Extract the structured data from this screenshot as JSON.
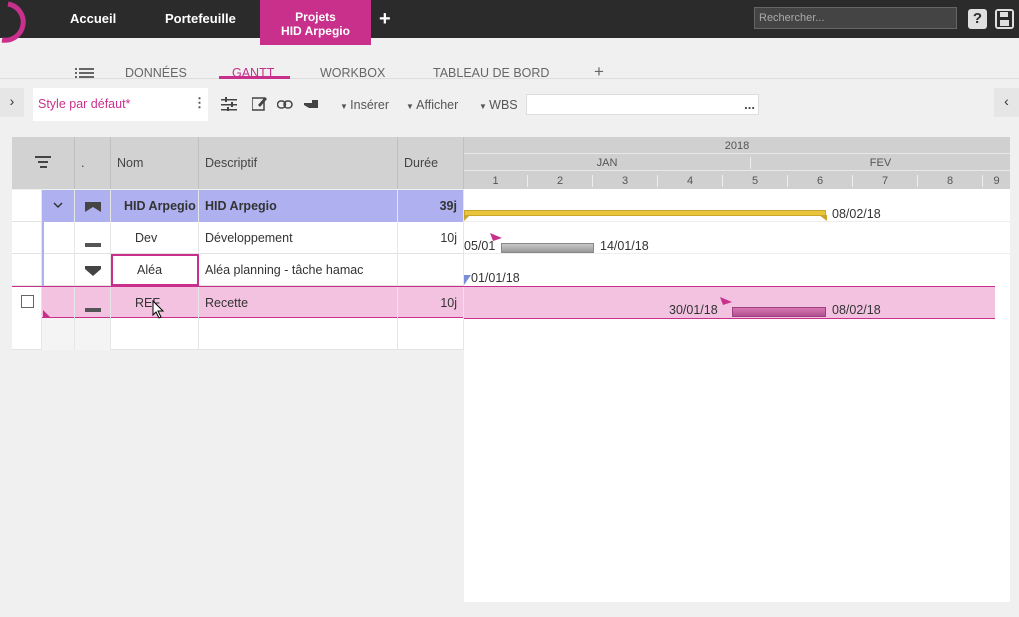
{
  "topbar": {
    "nav_home": "Accueil",
    "nav_portfolio": "Portefeuille",
    "nav_projects": "Projets",
    "nav_project_name": "HID Arpegio",
    "search_placeholder": "Rechercher...",
    "help_icon": "question-icon",
    "save_icon": "save-icon"
  },
  "tabs": {
    "donnees": "DONNÉES",
    "gantt": "GANTT",
    "workbox": "WORKBOX",
    "tableau": "TABLEAU DE BORD"
  },
  "toolbar": {
    "style": "Style par défaut*",
    "inserer": "Insérer",
    "afficher": "Afficher",
    "wbs": "WBS",
    "more": "..."
  },
  "grid": {
    "headers": {
      "dot": ".",
      "nom": "Nom",
      "descriptif": "Descriptif",
      "duree": "Durée"
    },
    "rows": [
      {
        "nom": "HID Arpegio",
        "descriptif": "HID Arpegio",
        "duree": "39j"
      },
      {
        "nom": "Dev",
        "descriptif": "Développement",
        "duree": "10j"
      },
      {
        "nom": "Aléa",
        "descriptif": "Aléa planning - tâche hamac",
        "duree": ""
      },
      {
        "nom": "REF",
        "descriptif": "Recette",
        "duree": "10j"
      }
    ]
  },
  "gantt": {
    "year": "2018",
    "months": [
      "JAN",
      "FEV"
    ],
    "weeks": [
      "1",
      "2",
      "3",
      "4",
      "5",
      "6",
      "7",
      "8",
      "9"
    ],
    "bars": [
      {
        "end_label": "08/02/18"
      },
      {
        "start_label": "05/01",
        "end_label": "14/01/18"
      },
      {
        "start_label": "01/01/18"
      },
      {
        "start_label": "30/01/18",
        "end_label": "08/02/18"
      }
    ]
  },
  "colors": {
    "accent": "#c8308c",
    "summary_row": "#aeb0f0",
    "selected_row": "#f2c2e0",
    "summary_bar": "#e8c53a"
  }
}
